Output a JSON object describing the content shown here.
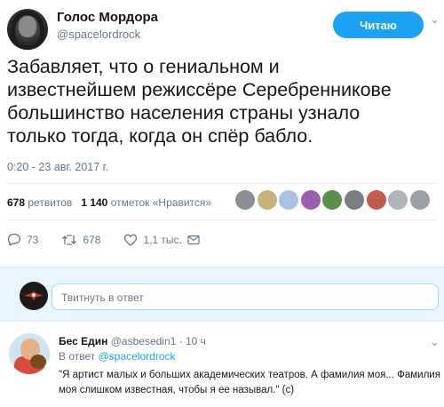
{
  "tweet": {
    "author_name": "Голос Мордора",
    "author_handle": "@spacelordrock",
    "follow_label": "Читаю",
    "text": "Забавляет, что о гениальном и\nизвестнейшем режиссёре Серебренникове\nбольшинство населения страны узнало\nтолько тогда, когда он спёр бабло.",
    "time": "0:20 - 23 авг. 2017 г.",
    "retweets_count": "678",
    "retweets_label": "ретвитов",
    "likes_count": "1 140",
    "likes_label": "отметок «Нравится»",
    "liker_colors": [
      "#8a8f96",
      "#c8b27c",
      "#a9c2e3",
      "#9b5fb0",
      "#5a8f4a",
      "#7a7d82",
      "#c45a4a",
      "#b0b5ba",
      "#9aa0a6"
    ],
    "actions": {
      "replies": "73",
      "retweets": "678",
      "likes": "1,1 тыс."
    }
  },
  "reply_box": {
    "placeholder": "Твитнуть в ответ"
  },
  "reply": {
    "name": "Бес Един",
    "handle": "@asbesedin1",
    "age": "· 10 ч",
    "in_reply_prefix": "В ответ",
    "in_reply_handle": "@spacelordrock",
    "text": "\"Я артист малых и больших академических театров. А фамилия моя... Фамилия моя слишком известная, чтобы я ее называл.\" (с)"
  },
  "colors": {
    "accent": "#1da1f2",
    "muted": "#657786",
    "reply_bg": "#e8f5fd"
  }
}
